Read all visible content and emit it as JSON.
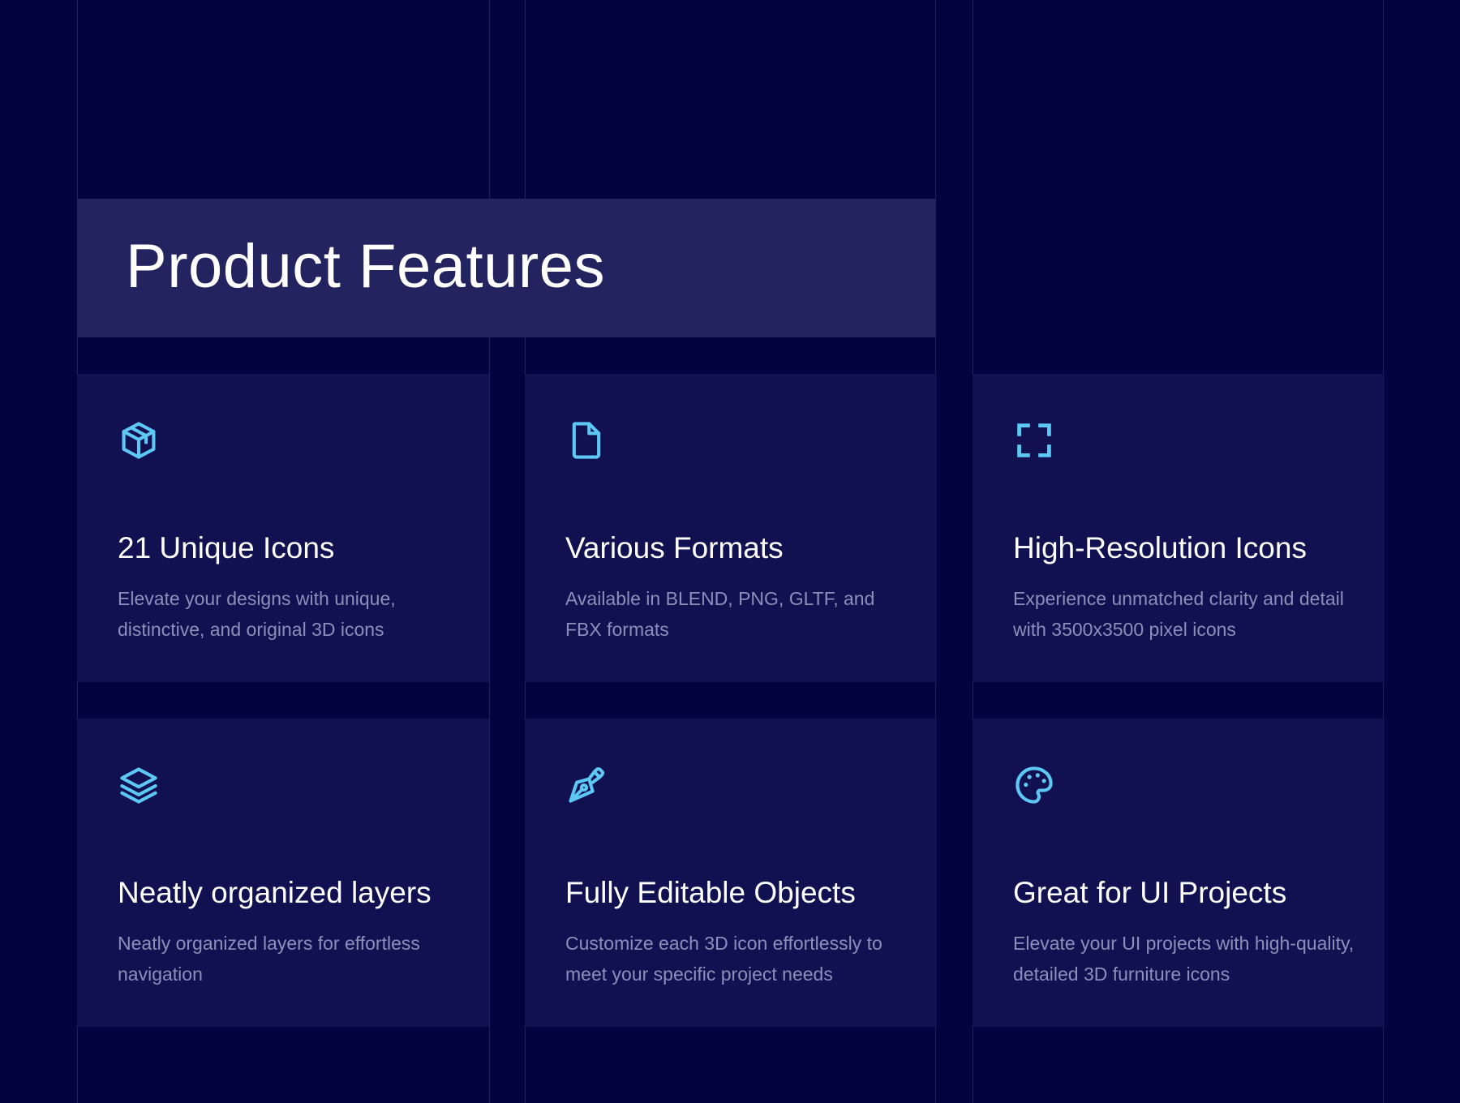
{
  "section": {
    "title": "Product Features"
  },
  "features": [
    {
      "icon": "cube-icon",
      "title": "21 Unique Icons",
      "description": "Elevate your designs with unique, distinctive, and original 3D icons"
    },
    {
      "icon": "file-icon",
      "title": "Various Formats",
      "description": "Available in BLEND, PNG, GLTF, and FBX formats"
    },
    {
      "icon": "maximize-icon",
      "title": "High-Resolution Icons",
      "description": "Experience unmatched clarity and detail with 3500x3500 pixel icons"
    },
    {
      "icon": "layers-icon",
      "title": "Neatly organized layers",
      "description": "Neatly organized layers for effortless navigation"
    },
    {
      "icon": "pen-tool-icon",
      "title": "Fully Editable Objects",
      "description": "Customize each 3D icon effortlessly to meet your specific project needs"
    },
    {
      "icon": "palette-icon",
      "title": "Great for UI Projects",
      "description": "Elevate your UI projects with high-quality, detailed 3D furniture icons"
    }
  ],
  "colors": {
    "background": "#02033f",
    "card": "#111152",
    "hero": "#23245f",
    "accent": "#5ec8f5",
    "muted_text": "#8c8fb8",
    "gridline": "#1f2160"
  }
}
